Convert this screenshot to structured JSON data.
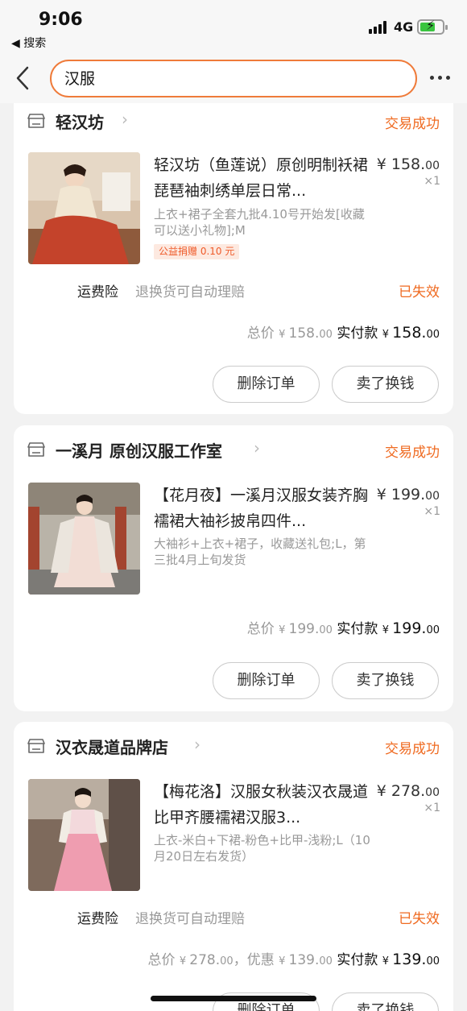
{
  "status_bar": {
    "time": "9:06",
    "back_app": "◀ 搜索",
    "network": "4G"
  },
  "search": {
    "value": "汉服"
  },
  "orders": [
    {
      "shop": "轻汉坊",
      "status": "交易成功",
      "title": "轻汉坊（鱼莲说）原创明制袄裙琵琶袖刺绣单层日常...",
      "price_int": "¥ 158.",
      "price_dec": "00",
      "qty": "×1",
      "spec": "上衣+裙子全套九批4.10号开始发[收藏可以送小礼物];M",
      "charity": "公益捐赠 0.10 元",
      "insurance": {
        "label": "运费险",
        "desc": "退换货可自动理赔",
        "state": "已失效"
      },
      "totals": {
        "total_label": "总价",
        "total_int": "158.",
        "total_dec": "00",
        "pay_label": "实付款",
        "pay_int": "158.",
        "pay_dec": "00"
      },
      "buttons": {
        "delete": "删除订单",
        "resell": "卖了换钱"
      }
    },
    {
      "shop": "一溪月 原创汉服工作室",
      "status": "交易成功",
      "title": "【花月夜】一溪月汉服女装齐胸襦裙大袖衫披帛四件...",
      "price_int": "¥ 199.",
      "price_dec": "00",
      "qty": "×1",
      "spec": "大袖衫+上衣+裙子，收藏送礼包;L，第三批4月上旬发货",
      "totals": {
        "total_label": "总价",
        "total_int": "199.",
        "total_dec": "00",
        "pay_label": "实付款",
        "pay_int": "199.",
        "pay_dec": "00"
      },
      "buttons": {
        "delete": "删除订单",
        "resell": "卖了换钱"
      }
    },
    {
      "shop": "汉衣晟道品牌店",
      "status": "交易成功",
      "title": "【梅花洛】汉服女秋装汉衣晟道比甲齐腰襦裙汉服3...",
      "price_int": "¥ 278.",
      "price_dec": "00",
      "qty": "×1",
      "spec": "上衣-米白+下裙-粉色+比甲-浅粉;L（10月20日左右发货）",
      "insurance": {
        "label": "运费险",
        "desc": "退换货可自动理赔",
        "state": "已失效"
      },
      "totals": {
        "total_label": "总价",
        "total_int": "278.",
        "total_dec": "00",
        "discount_label": "，优惠",
        "discount_int": "139.",
        "discount_dec": "00",
        "pay_label": "实付款",
        "pay_int": "139.",
        "pay_dec": "00"
      },
      "buttons": {
        "delete": "删除订单",
        "resell": "卖了换钱"
      }
    }
  ],
  "colors": {
    "accent": "#ef6a20",
    "search_border": "#ef7b3a",
    "muted": "#999999"
  },
  "icons": [
    "back-arrow-icon",
    "more-dots-icon",
    "shop-icon",
    "chevron-right-icon"
  ]
}
